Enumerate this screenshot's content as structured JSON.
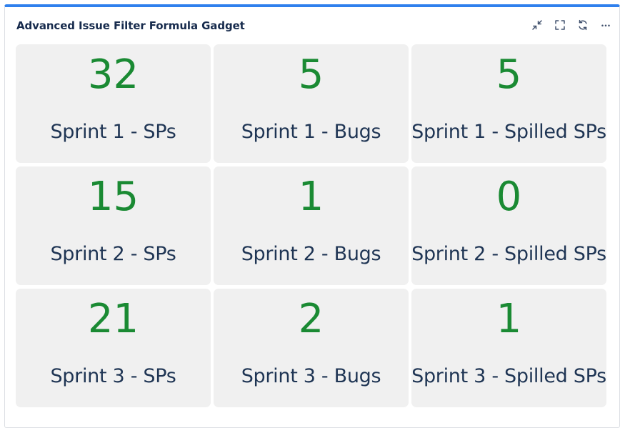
{
  "gadget": {
    "title": "Advanced Issue Filter Formula Gadget",
    "accent_color": "#2f80ed",
    "value_color": "#1a8a33",
    "label_color": "#1f3554",
    "toolbar": [
      {
        "icon": "minimize-icon"
      },
      {
        "icon": "maximize-icon"
      },
      {
        "icon": "refresh-icon"
      },
      {
        "icon": "more-icon"
      }
    ]
  },
  "tiles": [
    {
      "value": "32",
      "label": "Sprint 1 - SPs"
    },
    {
      "value": "5",
      "label": "Sprint 1 - Bugs"
    },
    {
      "value": "5",
      "label": "Sprint 1 - Spilled SPs"
    },
    {
      "value": "15",
      "label": "Sprint 2 - SPs"
    },
    {
      "value": "1",
      "label": "Sprint 2 - Bugs"
    },
    {
      "value": "0",
      "label": "Sprint 2 - Spilled SPs"
    },
    {
      "value": "21",
      "label": "Sprint 3 - SPs"
    },
    {
      "value": "2",
      "label": "Sprint 3 - Bugs"
    },
    {
      "value": "1",
      "label": "Sprint 3 - Spilled SPs"
    }
  ]
}
